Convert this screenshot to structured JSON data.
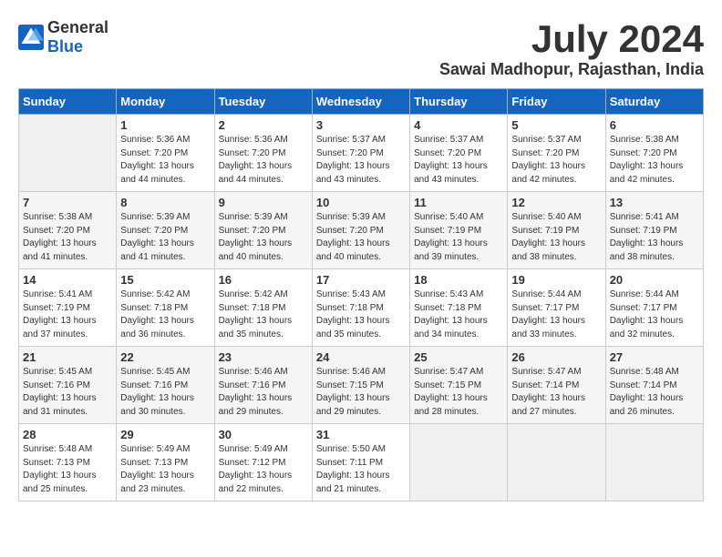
{
  "header": {
    "logo_general": "General",
    "logo_blue": "Blue",
    "month": "July 2024",
    "location": "Sawai Madhopur, Rajasthan, India"
  },
  "weekdays": [
    "Sunday",
    "Monday",
    "Tuesday",
    "Wednesday",
    "Thursday",
    "Friday",
    "Saturday"
  ],
  "weeks": [
    [
      {
        "day": "",
        "empty": true
      },
      {
        "day": "1",
        "sunrise": "5:36 AM",
        "sunset": "7:20 PM",
        "daylight": "13 hours and 44 minutes."
      },
      {
        "day": "2",
        "sunrise": "5:36 AM",
        "sunset": "7:20 PM",
        "daylight": "13 hours and 44 minutes."
      },
      {
        "day": "3",
        "sunrise": "5:37 AM",
        "sunset": "7:20 PM",
        "daylight": "13 hours and 43 minutes."
      },
      {
        "day": "4",
        "sunrise": "5:37 AM",
        "sunset": "7:20 PM",
        "daylight": "13 hours and 43 minutes."
      },
      {
        "day": "5",
        "sunrise": "5:37 AM",
        "sunset": "7:20 PM",
        "daylight": "13 hours and 42 minutes."
      },
      {
        "day": "6",
        "sunrise": "5:38 AM",
        "sunset": "7:20 PM",
        "daylight": "13 hours and 42 minutes."
      }
    ],
    [
      {
        "day": "7",
        "sunrise": "5:38 AM",
        "sunset": "7:20 PM",
        "daylight": "13 hours and 41 minutes."
      },
      {
        "day": "8",
        "sunrise": "5:39 AM",
        "sunset": "7:20 PM",
        "daylight": "13 hours and 41 minutes."
      },
      {
        "day": "9",
        "sunrise": "5:39 AM",
        "sunset": "7:20 PM",
        "daylight": "13 hours and 40 minutes."
      },
      {
        "day": "10",
        "sunrise": "5:39 AM",
        "sunset": "7:20 PM",
        "daylight": "13 hours and 40 minutes."
      },
      {
        "day": "11",
        "sunrise": "5:40 AM",
        "sunset": "7:19 PM",
        "daylight": "13 hours and 39 minutes."
      },
      {
        "day": "12",
        "sunrise": "5:40 AM",
        "sunset": "7:19 PM",
        "daylight": "13 hours and 38 minutes."
      },
      {
        "day": "13",
        "sunrise": "5:41 AM",
        "sunset": "7:19 PM",
        "daylight": "13 hours and 38 minutes."
      }
    ],
    [
      {
        "day": "14",
        "sunrise": "5:41 AM",
        "sunset": "7:19 PM",
        "daylight": "13 hours and 37 minutes."
      },
      {
        "day": "15",
        "sunrise": "5:42 AM",
        "sunset": "7:18 PM",
        "daylight": "13 hours and 36 minutes."
      },
      {
        "day": "16",
        "sunrise": "5:42 AM",
        "sunset": "7:18 PM",
        "daylight": "13 hours and 35 minutes."
      },
      {
        "day": "17",
        "sunrise": "5:43 AM",
        "sunset": "7:18 PM",
        "daylight": "13 hours and 35 minutes."
      },
      {
        "day": "18",
        "sunrise": "5:43 AM",
        "sunset": "7:18 PM",
        "daylight": "13 hours and 34 minutes."
      },
      {
        "day": "19",
        "sunrise": "5:44 AM",
        "sunset": "7:17 PM",
        "daylight": "13 hours and 33 minutes."
      },
      {
        "day": "20",
        "sunrise": "5:44 AM",
        "sunset": "7:17 PM",
        "daylight": "13 hours and 32 minutes."
      }
    ],
    [
      {
        "day": "21",
        "sunrise": "5:45 AM",
        "sunset": "7:16 PM",
        "daylight": "13 hours and 31 minutes."
      },
      {
        "day": "22",
        "sunrise": "5:45 AM",
        "sunset": "7:16 PM",
        "daylight": "13 hours and 30 minutes."
      },
      {
        "day": "23",
        "sunrise": "5:46 AM",
        "sunset": "7:16 PM",
        "daylight": "13 hours and 29 minutes."
      },
      {
        "day": "24",
        "sunrise": "5:46 AM",
        "sunset": "7:15 PM",
        "daylight": "13 hours and 29 minutes."
      },
      {
        "day": "25",
        "sunrise": "5:47 AM",
        "sunset": "7:15 PM",
        "daylight": "13 hours and 28 minutes."
      },
      {
        "day": "26",
        "sunrise": "5:47 AM",
        "sunset": "7:14 PM",
        "daylight": "13 hours and 27 minutes."
      },
      {
        "day": "27",
        "sunrise": "5:48 AM",
        "sunset": "7:14 PM",
        "daylight": "13 hours and 26 minutes."
      }
    ],
    [
      {
        "day": "28",
        "sunrise": "5:48 AM",
        "sunset": "7:13 PM",
        "daylight": "13 hours and 25 minutes."
      },
      {
        "day": "29",
        "sunrise": "5:49 AM",
        "sunset": "7:13 PM",
        "daylight": "13 hours and 23 minutes."
      },
      {
        "day": "30",
        "sunrise": "5:49 AM",
        "sunset": "7:12 PM",
        "daylight": "13 hours and 22 minutes."
      },
      {
        "day": "31",
        "sunrise": "5:50 AM",
        "sunset": "7:11 PM",
        "daylight": "13 hours and 21 minutes."
      },
      {
        "day": "",
        "empty": true
      },
      {
        "day": "",
        "empty": true
      },
      {
        "day": "",
        "empty": true
      }
    ]
  ],
  "labels": {
    "sunrise_prefix": "Sunrise: ",
    "sunset_prefix": "Sunset: ",
    "daylight_prefix": "Daylight: "
  }
}
